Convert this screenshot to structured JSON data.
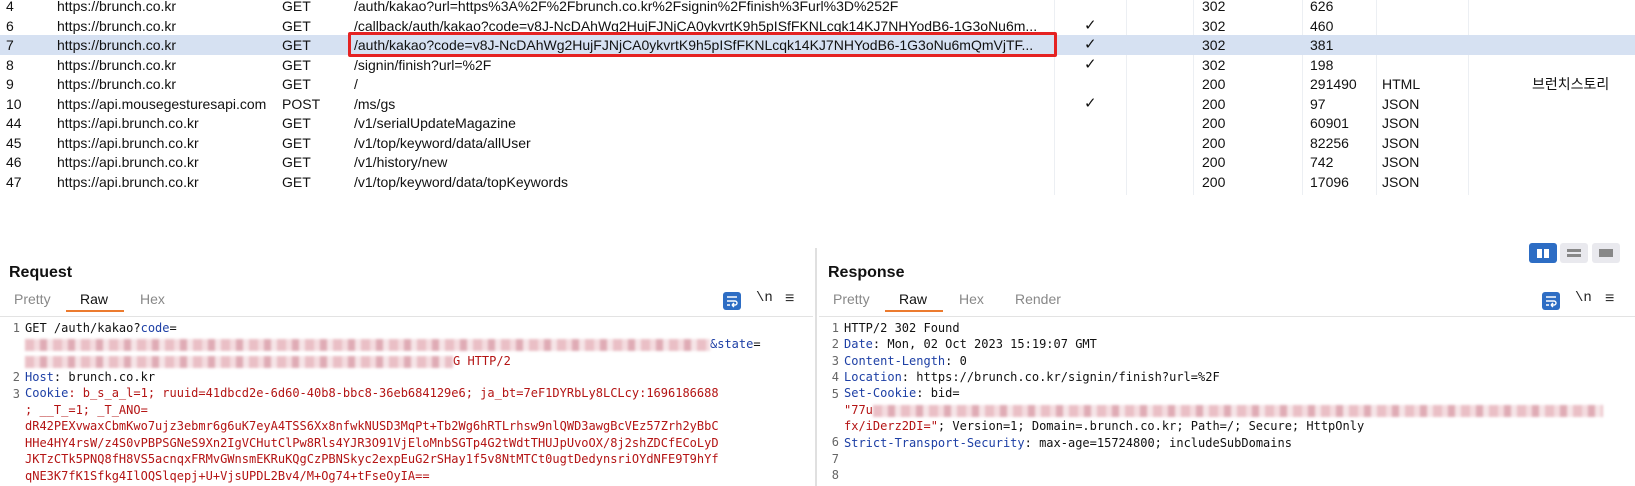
{
  "history": {
    "rows": [
      {
        "num": "4",
        "host": "https://brunch.co.kr",
        "method": "GET",
        "url": "/auth/kakao?url=https%3A%2F%2Fbrunch.co.kr%2Fsignin%2Ffinish%3Furl%3D%252F",
        "edited": "",
        "status": "302",
        "length": "626",
        "mime": "",
        "title": ""
      },
      {
        "num": "6",
        "host": "https://brunch.co.kr",
        "method": "GET",
        "url": "/callback/auth/kakao?code=v8J-NcDAhWg2HujFJNjCA0ykvrtK9h5pISfFKNLcqk14KJ7NHYodB6-1G3oNu6m...",
        "edited": "✓",
        "status": "302",
        "length": "460",
        "mime": "",
        "title": ""
      },
      {
        "num": "7",
        "host": "https://brunch.co.kr",
        "method": "GET",
        "url": "/auth/kakao?code=v8J-NcDAhWg2HujFJNjCA0ykvrtK9h5pISfFKNLcqk14KJ7NHYodB6-1G3oNu6mQmVjTF...",
        "edited": "✓",
        "status": "302",
        "length": "381",
        "mime": "",
        "title": ""
      },
      {
        "num": "8",
        "host": "https://brunch.co.kr",
        "method": "GET",
        "url": "/signin/finish?url=%2F",
        "edited": "✓",
        "status": "302",
        "length": "198",
        "mime": "",
        "title": ""
      },
      {
        "num": "9",
        "host": "https://brunch.co.kr",
        "method": "GET",
        "url": "/",
        "edited": "",
        "status": "200",
        "length": "291490",
        "mime": "HTML",
        "title": "브런치스토리"
      },
      {
        "num": "10",
        "host": "https://api.mousegesturesapi.com",
        "method": "POST",
        "url": "/ms/gs",
        "edited": "✓",
        "status": "200",
        "length": "97",
        "mime": "JSON",
        "title": ""
      },
      {
        "num": "44",
        "host": "https://api.brunch.co.kr",
        "method": "GET",
        "url": "/v1/serialUpdateMagazine",
        "edited": "",
        "status": "200",
        "length": "60901",
        "mime": "JSON",
        "title": ""
      },
      {
        "num": "45",
        "host": "https://api.brunch.co.kr",
        "method": "GET",
        "url": "/v1/top/keyword/data/allUser",
        "edited": "",
        "status": "200",
        "length": "82256",
        "mime": "JSON",
        "title": ""
      },
      {
        "num": "46",
        "host": "https://api.brunch.co.kr",
        "method": "GET",
        "url": "/v1/history/new",
        "edited": "",
        "status": "200",
        "length": "742",
        "mime": "JSON",
        "title": ""
      },
      {
        "num": "47",
        "host": "https://api.brunch.co.kr",
        "method": "GET",
        "url": "/v1/top/keyword/data/topKeywords",
        "edited": "",
        "status": "200",
        "length": "17096",
        "mime": "JSON",
        "title": ""
      }
    ]
  },
  "request": {
    "title": "Request",
    "tabs": [
      "Pretty",
      "Raw",
      "Hex"
    ],
    "wrap_label": "\\n",
    "menu_icon": "hamburger-menu-icon",
    "line1_prefix": "GET /auth/kakao?",
    "line1_key": "code",
    "line1_eq": "=",
    "line1_state_key": "&state",
    "line1_state_eq": "=",
    "line1_tail": "G HTTP/2",
    "host_key": "Host",
    "host_val": ": brunch.co.kr",
    "cookie_key": "Cookie",
    "cookie_line1": ": b_s_a_l=1; ruuid=41dbcd2e-6d60-40b8-bbc8-36eb684129e6; ja_bt=7eF1DYRbLy8LCLcy:1696186688",
    "cookie_line2": "; __T_=1; _T_ANO=",
    "cookie_line3": "dR42PEXvwaxCbmKwo7ujz3ebmr6g6uK7eyA4TSS6Xx8nfwkNUSD3MqPt+Tb2Wg6hRTLrhsw9nlQWD3awgBcVEz57Zrh2yBbC",
    "cookie_line4": "HHe4HY4rsW/z4S0vPBPSGNeS9Xn2IgVCHutClPw8Rls4YJR3O91VjEloMnbSGTp4G2tWdtTHUJpUvoOX/8j2shZDCfECoLyD",
    "cookie_line5": "JKTzCTk5PNQ8fH8VS5acnqxFRMvGWnsmEKRuKQgCzPBNSkyc2expEuG2rSHay1f5v8NtMTCt0ugtDedynsriOYdNFE9T9hYf",
    "cookie_line6": "qNE3K7fK1Sfkg4IlOQSlqepj+U+VjsUPDL2Bv4/M+Og74+tFseOyIA=="
  },
  "response": {
    "title": "Response",
    "tabs": [
      "Pretty",
      "Raw",
      "Hex",
      "Render"
    ],
    "wrap_label": "\\n",
    "status_line": "HTTP/2 302 Found",
    "date_key": "Date",
    "date_val": ": Mon, 02 Oct 2023 15:19:07 GMT",
    "cl_key": "Content-Length",
    "cl_val": ": 0",
    "loc_key": "Location",
    "loc_val": ": https://brunch.co.kr/signin/finish?url=%2F",
    "sc_key": "Set-Cookie",
    "sc_val": ": bid=",
    "sc_line2_start": "\"77u",
    "sc_line3_start": "fx/iDerz2DI=\"",
    "sc_line3_rest": "; Version=1; Domain=.brunch.co.kr; Path=/; Secure; HttpOnly",
    "hsts_key": "Strict-Transport-Security",
    "hsts_val": ": max-age=15724800; includeSubDomains"
  },
  "line_numbers_req": [
    "1",
    "2",
    "3"
  ],
  "line_numbers_resp": [
    "1",
    "2",
    "3",
    "4",
    "5",
    "6",
    "7",
    "8"
  ],
  "colors": {
    "accent": "#2d6dc4",
    "selection": "#d6e1f2",
    "highlight_box": "#e52222",
    "tab_underline": "#ec7b2f",
    "header_key": "#1d3fa5",
    "header_value": "#b41414"
  }
}
